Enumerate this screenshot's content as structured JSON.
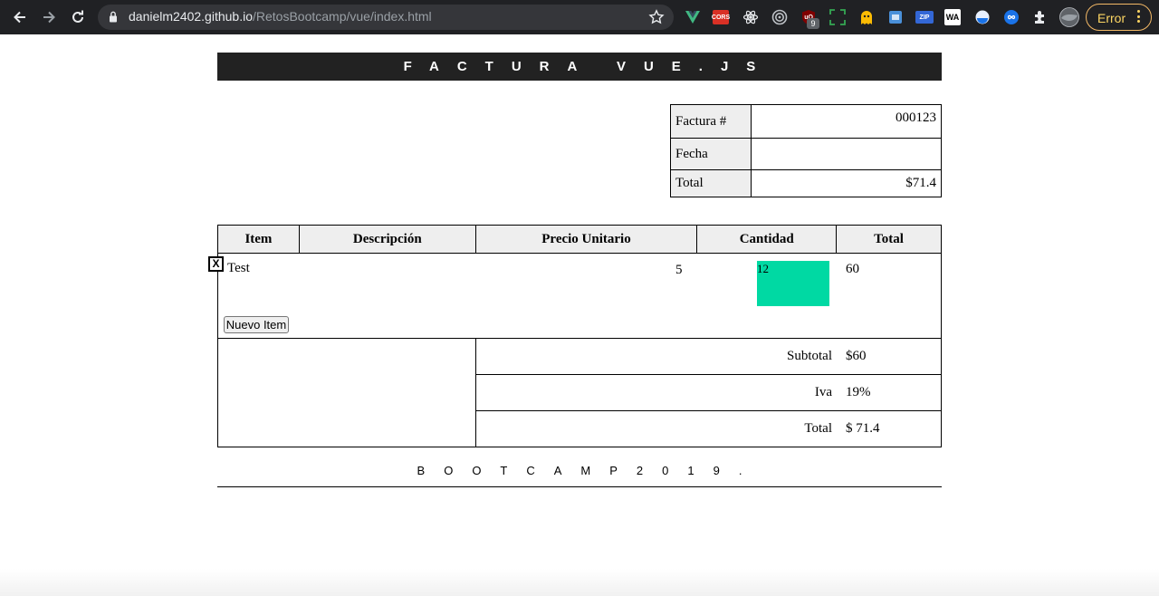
{
  "browser": {
    "url_host": "danielm2402.github.io",
    "url_path": "/RetosBootcamp/vue/index.html",
    "extensions": [
      "vue-devtools-icon",
      "cors-icon",
      "react-devtools-icon",
      "target-icon",
      "ublock-icon",
      "screenshot-icon",
      "ghost-icon",
      "blue-square-icon",
      "zip-icon",
      "wa-icon",
      "blue-circle-icon",
      "infinity-icon",
      "puzzle-icon"
    ],
    "cors_label": "CORS",
    "zip_label": "ZIP",
    "wa_label": "WA",
    "ublock_badge": "9",
    "error_label": "Error"
  },
  "invoice": {
    "title": "FACTURA VUE.JS",
    "meta": {
      "number_label": "Factura #",
      "number_value": "000123",
      "date_label": "Fecha",
      "date_value": "",
      "total_label": "Total",
      "total_value": "$71.4"
    },
    "columns": [
      "Item",
      "Descripción",
      "Precio Unitario",
      "Cantidad",
      "Total"
    ],
    "items": [
      {
        "delete_label": "X",
        "item": "Test",
        "description": "",
        "unit_price": "5",
        "quantity": "12",
        "total": "60"
      }
    ],
    "new_item_label": "Nuevo Item",
    "summary": {
      "subtotal_label": "Subtotal",
      "subtotal_value": "$60",
      "iva_label": "Iva",
      "iva_value": "19%",
      "total_label": "Total",
      "total_value": "$ 71.4"
    },
    "footer": "BOOTCAMP2019."
  },
  "colors": {
    "chrome_bg": "#202124",
    "title_bar_bg": "#222222",
    "header_cell_bg": "#eeeeee",
    "quantity_input_bg": "#00d9a3",
    "error_accent": "#fdd663"
  }
}
